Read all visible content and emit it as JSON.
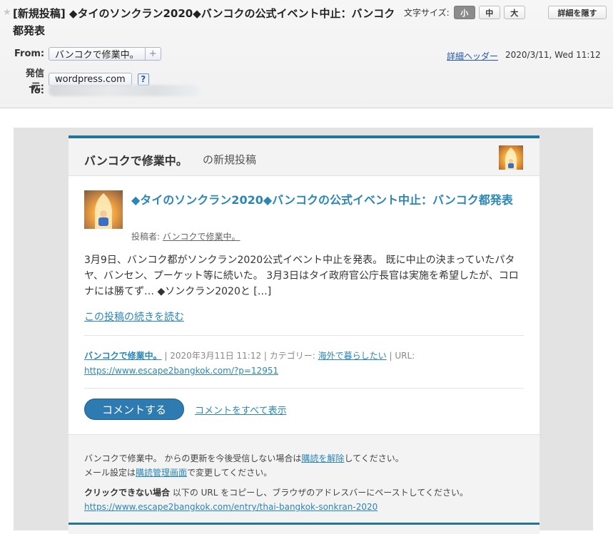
{
  "header": {
    "subject": "[新規投稿] ◆タイのソンクラン2020◆バンコクの公式イベント中止：バンコク都発表",
    "font_size_label": "文字サイズ:",
    "font_sizes": [
      "小",
      "中",
      "大"
    ],
    "hide_details": "詳細を隠す",
    "from_label": "From:",
    "from_name": "バンコクで修業中。",
    "from_plus": "+",
    "sender_label": "発信元:",
    "sender_domain": "wordpress.com",
    "sender_help": "?",
    "to_label": "To:",
    "detail_header_link": "詳細ヘッダー",
    "date": "2020/3/11, Wed 11:12"
  },
  "email": {
    "blog_name": "バンコクで修業中。",
    "heading_suffix": "の新規投稿",
    "post_title": "◆タイのソンクラン2020◆バンコクの公式イベント中止：バンコク都発表",
    "author_prefix": "投稿者:",
    "author_name": "バンコクで修業中。",
    "excerpt": "3月9日、バンコク都がソンクラン2020公式イベント中止を発表。 既に中止の決まっていたパタヤ、バンセン、プーケット等に続いた。 3月3日はタイ政府官公庁長官は実施を希望したが、コロナには勝てず… ◆ソンクラン2020と […]",
    "read_more": "この投稿の続きを読む",
    "meta_blog": "バンコクで修業中。",
    "meta_sep1": " | 2020年3月11日 11:12 | カテゴリー: ",
    "meta_category": "海外で暮らしたい",
    "meta_sep2": " | URL: ",
    "meta_url": "https://www.escape2bangkok.com/?p=12951",
    "comment_button": "コメントする",
    "all_comments": "コメントをすべて表示",
    "footer": {
      "unsub_pre": "バンコクで修業中。 からの更新を今後受信しない場合は",
      "unsub_link": "購読を解除",
      "unsub_post": "してください。",
      "settings_pre": "メール設定は",
      "settings_link": "購読管理画面",
      "settings_post": "で変更してください。",
      "noclick_bold": "クリックできない場合",
      "noclick_text": " 以下の URL をコピーし、ブラウザのアドレスバーにペーストしてください。",
      "post_url": "https://www.escape2bangkok.com/entry/thai-bangkok-sonkran-2020"
    }
  },
  "colors": {
    "accent": "#21759b",
    "link": "#2b86b8",
    "button": "#2e7bb2"
  }
}
